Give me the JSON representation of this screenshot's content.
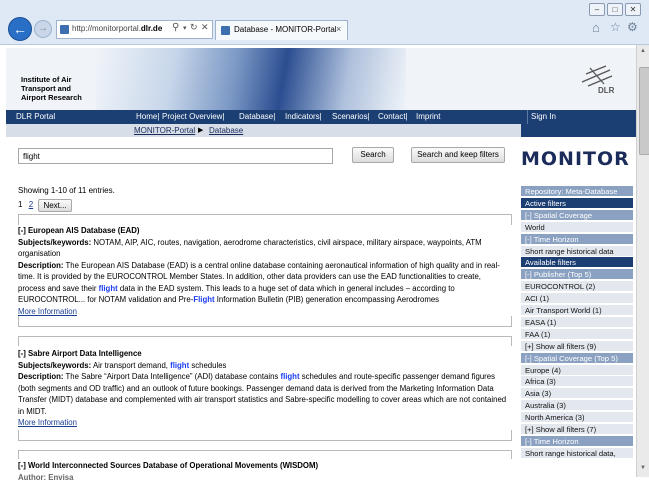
{
  "browser": {
    "url_prefix": "http://monitorportal.",
    "url_domain": "dlr.de",
    "tab_title": "Database - MONITOR-Portal",
    "tab_close": "×"
  },
  "header": {
    "institute_line1": "Institute of Air",
    "institute_line2": "Transport and",
    "institute_line3": "Airport Research",
    "logo_text": "DLR"
  },
  "nav": {
    "portal": "DLR Portal",
    "items": [
      "Home|",
      "Project Overview|",
      "Database|",
      "Indicators|",
      "Scenarios|",
      "Contact|",
      "Imprint"
    ],
    "sign_in": "Sign In"
  },
  "breadcrumb": {
    "root": "MONITOR-Portal",
    "arrow": "▶",
    "current": "Database"
  },
  "search": {
    "value": "flight",
    "search_label": "Search",
    "keep_filters_label": "Search and keep filters"
  },
  "brand": "MONITOR",
  "results": {
    "summary": "Showing 1-10 of 11 entries.",
    "pages": [
      "1",
      "2"
    ],
    "next_label": "Next...",
    "items": [
      {
        "title": "[-] European AIS Database (EAD)",
        "subjects_label": "Subjects/keywords:",
        "subjects": " NOTAM, AIP, AIC, routes, navigation, aerodrome characteristics, civil airspace, military airspace, waypoints, ATM organisation",
        "desc_label": "Description:",
        "desc_part1": " The European AIS Database (EAD) is a central online database containing aeronautical information of high quality and in real-time. It is provided by the EUROCONTROL Member States. In addition, other data providers can use the EAD functionalities to create, process and save their ",
        "desc_hl1": "flight",
        "desc_part2": " data in the EAD system. This leads to a huge set of data which in general includes – according to EUROCONTROL... for NOTAM validation and Pre-",
        "desc_hl2": "Flight",
        "desc_part3": " Information Bulletin (PIB) generation encompassing Aerodromes",
        "more": "More Information"
      },
      {
        "title": "[-] Sabre Airport Data Intelligence",
        "subjects_label": "Subjects/keywords:",
        "subjects_pre": " Air transport demand, ",
        "subjects_hl": "flight",
        "subjects_post": " schedules",
        "desc_label": "Description:",
        "desc_part1": " The Sabre “Airport Data Intelligence” (ADI) database contains ",
        "desc_hl1": "flight",
        "desc_part2": " schedules and route-specific passenger demand figures (both segments and OD traffic) and an outlook of future bookings. Passenger demand data is derived from the Marketing Information Data Transfer (MIDT) database and complemented with air transport statistics and Sabre-specific modelling to cover areas which are not contained in MIDT.",
        "more": "More Information"
      },
      {
        "title": "[-] World Interconnected Sources Database of Operational Movements (WISDOM)",
        "author_partial": "Author: Envisa"
      }
    ]
  },
  "sidebar": [
    {
      "text": "Repository: Meta-Database",
      "style": "mid"
    },
    {
      "text": "Active filters",
      "style": "dark"
    },
    {
      "text": "[-] Spatial Coverage",
      "style": "mid"
    },
    {
      "text": "World",
      "style": "light"
    },
    {
      "text": "[-] Time Horizon",
      "style": "mid"
    },
    {
      "text": "Short range historical data",
      "style": "light"
    },
    {
      "text": "Available filters",
      "style": "dark"
    },
    {
      "text": "[-] Publisher (Top 5)",
      "style": "mid"
    },
    {
      "text": "EUROCONTROL (2)",
      "style": "light"
    },
    {
      "text": "ACI (1)",
      "style": "light"
    },
    {
      "text": "Air Transport World  (1)",
      "style": "light"
    },
    {
      "text": "EASA (1)",
      "style": "light"
    },
    {
      "text": "FAA (1)",
      "style": "light"
    },
    {
      "text": "[+] Show all filters (9)",
      "style": "light"
    },
    {
      "text": "[-] Spatial Coverage (Top 5)",
      "style": "mid"
    },
    {
      "text": "Europe (4)",
      "style": "light"
    },
    {
      "text": "Africa (3)",
      "style": "light"
    },
    {
      "text": "Asia (3)",
      "style": "light"
    },
    {
      "text": "Australia (3)",
      "style": "light"
    },
    {
      "text": "North America (3)",
      "style": "light"
    },
    {
      "text": "[+] Show all filters (7)",
      "style": "light"
    },
    {
      "text": "[-] Time Horizon",
      "style": "mid"
    },
    {
      "text": "Short range historical data,",
      "style": "light"
    }
  ],
  "colors": {
    "nav_bg": "#1b3e73",
    "filter_header": "#8aa1c1",
    "filter_item": "#e3e8ef",
    "highlight": "#1a3cf0",
    "link": "#1a3d91"
  }
}
